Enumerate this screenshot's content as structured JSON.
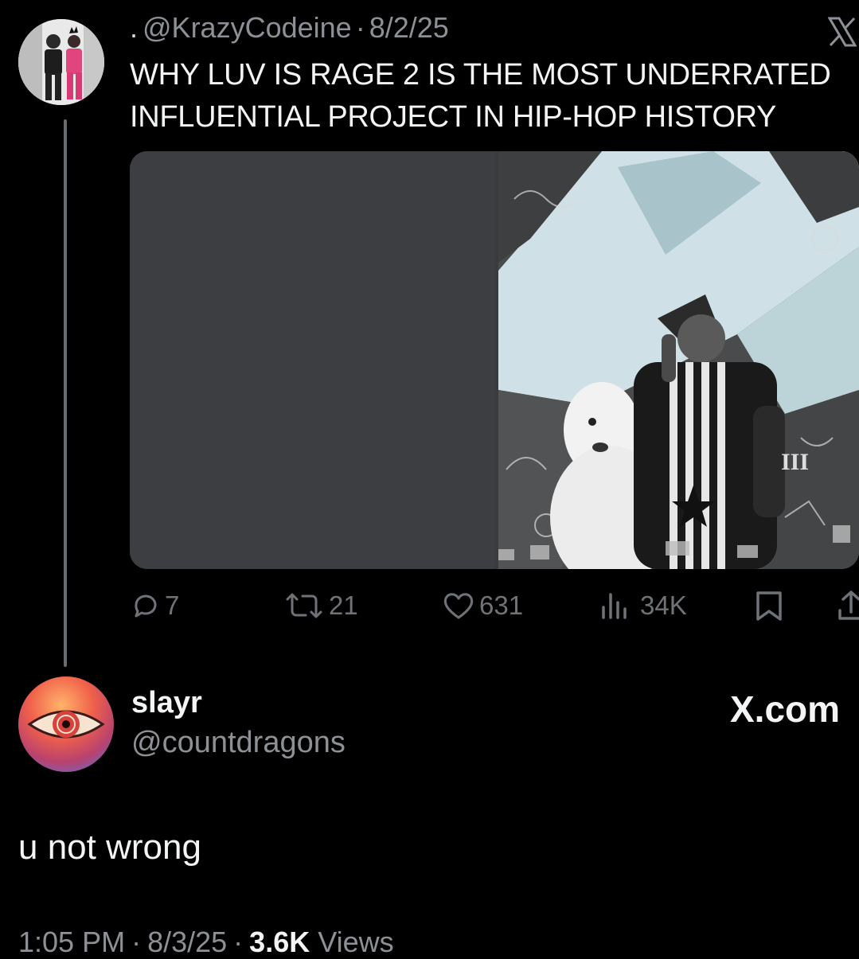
{
  "quoted_tweet": {
    "leading_dot": ".",
    "handle": "@KrazyCodeine",
    "separator": "·",
    "date": "8/2/25",
    "text": "WHY LUV IS RAGE 2 IS THE MOST UNDERRATED INFLUENTIAL PROJECT IN HIP-HOP HISTORY",
    "close_icon": "x-close-icon",
    "actions": {
      "replies": "7",
      "reposts": "21",
      "likes": "631",
      "views": "34K"
    }
  },
  "reply": {
    "display_name": "slayr",
    "handle": "@countdragons",
    "text": "u not wrong",
    "time": "1:05 PM",
    "separator": "·",
    "date": "8/3/25",
    "views_count": "3.6K",
    "views_label": "Views"
  },
  "watermark": "X.com",
  "colors": {
    "background": "#000000",
    "primary_text": "#f3f4f5",
    "secondary_text": "#8d9196",
    "media_placeholder": "#3d3e42"
  }
}
